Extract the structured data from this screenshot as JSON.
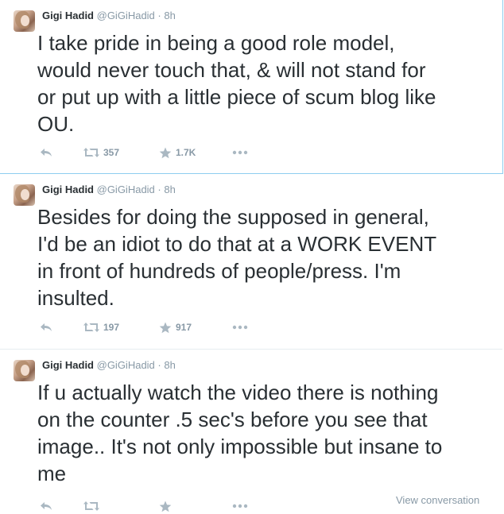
{
  "tweets": [
    {
      "name": "Gigi Hadid",
      "handle": "@GiGiHadid",
      "separator": "·",
      "time": "8h",
      "text": "I take pride in being a good role model,\nwould never touch that, & will not stand for\nor put up with a little piece of scum blog like\nOU.",
      "retweets": "357",
      "favorites": "1.7K"
    },
    {
      "name": "Gigi Hadid",
      "handle": "@GiGiHadid",
      "separator": "·",
      "time": "8h",
      "text": "Besides for doing the supposed in general,\nI'd be an idiot to do that at a WORK EVENT\nin front of hundreds of people/press. I'm\ninsulted.",
      "retweets": "197",
      "favorites": "917"
    },
    {
      "name": "Gigi Hadid",
      "handle": "@GiGiHadid",
      "separator": "·",
      "time": "8h",
      "text": "If u actually watch the video there is nothing\non the counter .5 sec's before you see that\nimage.. It's not only impossible but insane to\nme",
      "retweets": "",
      "favorites": "",
      "view_conversation": "View conversation"
    }
  ],
  "icons": {
    "reply": "reply-icon",
    "retweet": "retweet-icon",
    "favorite": "star-icon",
    "more": "more-icon"
  },
  "colors": {
    "text": "#292f33",
    "muted": "#8899a6",
    "selected_border": "#8ecdf0"
  }
}
